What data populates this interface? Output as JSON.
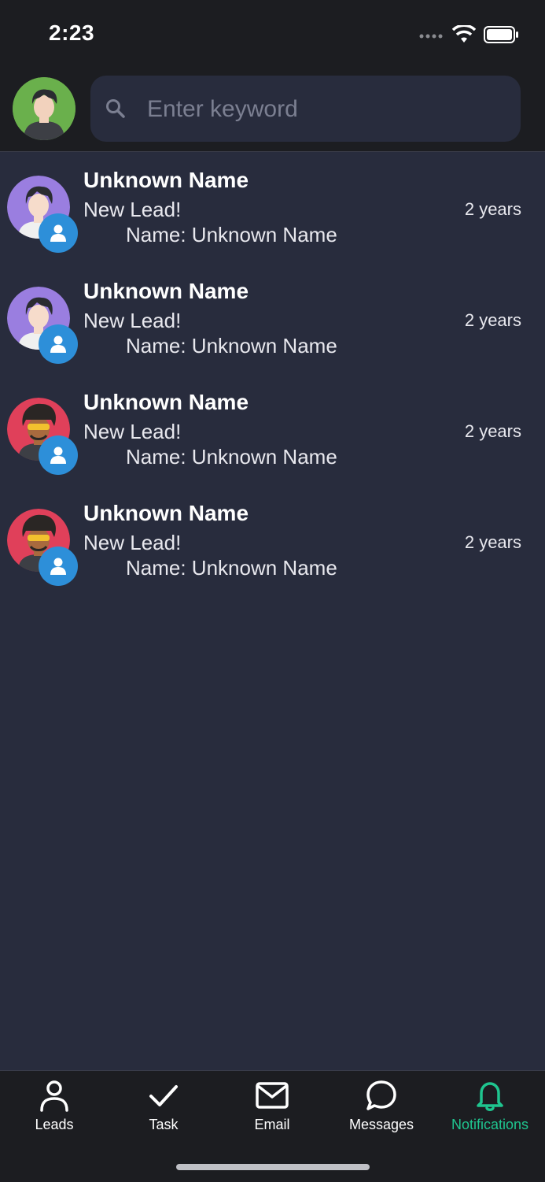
{
  "status": {
    "time": "2:23"
  },
  "search": {
    "placeholder": "Enter keyword"
  },
  "notifications": [
    {
      "title": "Unknown Name",
      "subtitle": "New Lead!",
      "detail": "Name: Unknown Name",
      "time": "2 years",
      "avatar": "purple-avatar"
    },
    {
      "title": "Unknown Name",
      "subtitle": "New Lead!",
      "detail": "Name: Unknown Name",
      "time": "2 years",
      "avatar": "purple-avatar"
    },
    {
      "title": "Unknown Name",
      "subtitle": "New Lead!",
      "detail": "Name: Unknown Name",
      "time": "2 years",
      "avatar": "red-avatar"
    },
    {
      "title": "Unknown Name",
      "subtitle": "New Lead!",
      "detail": "Name: Unknown Name",
      "time": "2 years",
      "avatar": "red-avatar"
    }
  ],
  "tabs": [
    {
      "label": "Leads",
      "icon": "person-icon",
      "active": false
    },
    {
      "label": "Task",
      "icon": "check-icon",
      "active": false
    },
    {
      "label": "Email",
      "icon": "mail-icon",
      "active": false
    },
    {
      "label": "Messages",
      "icon": "chat-bubble-icon",
      "active": false
    },
    {
      "label": "Notifications",
      "icon": "bell-icon",
      "active": true
    }
  ],
  "colors": {
    "background": "#282c3d",
    "header": "#1c1d21",
    "accent": "#1fc58f",
    "badge": "#2d8fd9"
  }
}
